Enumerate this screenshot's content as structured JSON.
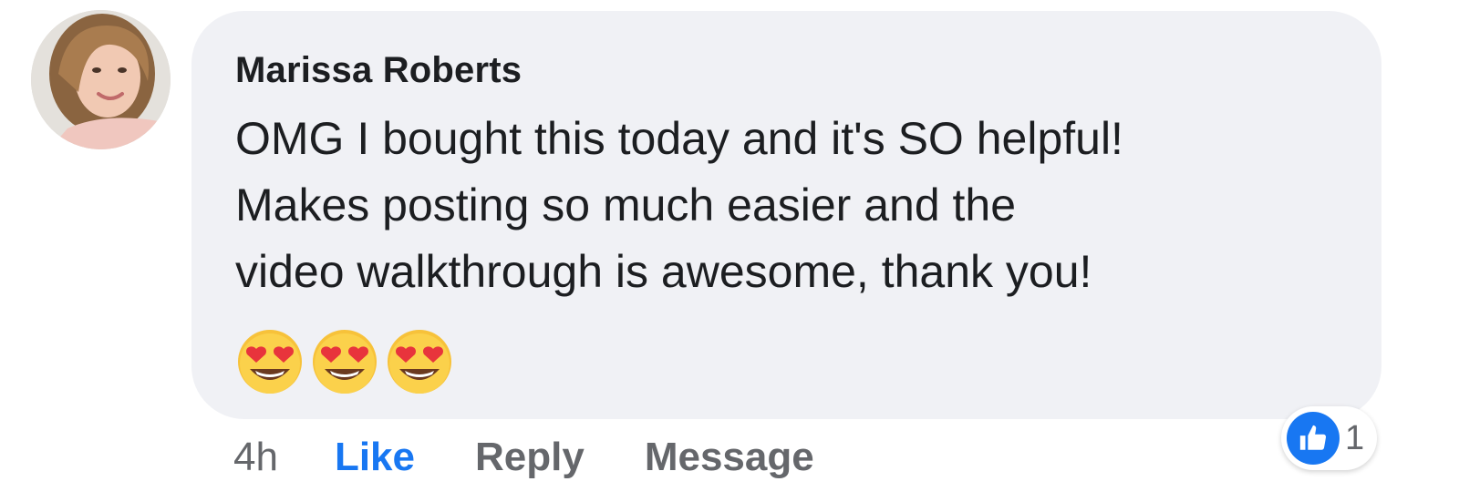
{
  "comment": {
    "author": "Marissa Roberts",
    "lines": [
      "OMG I bought this today and it's SO helpful!",
      "Makes posting so much easier and the",
      "video walkthrough is awesome, thank you!"
    ],
    "emojis": [
      "heart-eyes",
      "heart-eyes",
      "heart-eyes"
    ]
  },
  "actions": {
    "time": "4h",
    "like_label": "Like",
    "reply_label": "Reply",
    "message_label": "Message"
  },
  "reactions": {
    "icon": "like-thumb-icon",
    "count": "1"
  },
  "colors": {
    "bubble": "#f0f1f5",
    "like_blue": "#1877f2",
    "muted": "#65676b",
    "text": "#1c1e21"
  }
}
